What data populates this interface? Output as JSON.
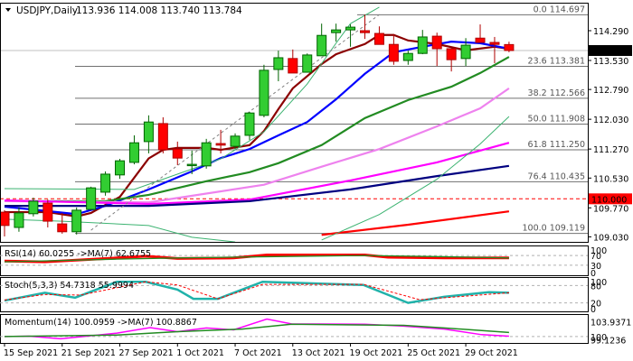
{
  "header": {
    "symbol": "USDJPY,Daily",
    "ohlc": "113.936 114.008 113.740 113.784"
  },
  "colors": {
    "bull": "#32cd32",
    "bear": "#ff0000",
    "bull_border": "#006400",
    "bear_border": "#b00000",
    "ma_fast": "#8b0000",
    "ma_blue": "#0000ff",
    "ma_green": "#228b22",
    "ma_violet": "#ee82ee",
    "ma_magenta": "#ff00ff",
    "ma_navy": "#000080",
    "ma_red": "#ff0000",
    "bollinger": "#3cb371",
    "stoch_main": "#20b2aa"
  },
  "chart_data": [
    {
      "type": "candlestick",
      "title": "USDJPY,Daily",
      "x_tick_labels": [
        {
          "bar": 0,
          "label": "15 Sep 2021"
        },
        {
          "bar": 4,
          "label": "21 Sep 2021"
        },
        {
          "bar": 8,
          "label": "27 Sep 2021"
        },
        {
          "bar": 12,
          "label": "1 Oct 2021"
        },
        {
          "bar": 16,
          "label": "7 Oct 2021"
        },
        {
          "bar": 20,
          "label": "13 Oct 2021"
        },
        {
          "bar": 24,
          "label": "19 Oct 2021"
        },
        {
          "bar": 28,
          "label": "25 Oct 2021"
        },
        {
          "bar": 32,
          "label": "29 Oct 2021"
        }
      ],
      "y_tick_labels": [
        "114.290",
        "113.530",
        "112.790",
        "112.030",
        "111.270",
        "110.530",
        "109.770",
        "109.030"
      ],
      "ylim": [
        109.0,
        114.75
      ],
      "current_price": {
        "label": "113.784",
        "value": 113.784
      },
      "level_line": {
        "label": "110.000",
        "value": 110.0
      },
      "candles": [
        [
          109.66,
          109.71,
          109.04,
          109.32
        ],
        [
          109.27,
          109.78,
          109.16,
          109.64
        ],
        [
          109.62,
          110.03,
          109.55,
          109.94
        ],
        [
          109.89,
          109.98,
          109.27,
          109.43
        ],
        [
          109.36,
          109.64,
          109.11,
          109.16
        ],
        [
          109.16,
          109.78,
          109.09,
          109.71
        ],
        [
          109.73,
          110.31,
          109.71,
          110.28
        ],
        [
          110.17,
          110.7,
          110.08,
          110.63
        ],
        [
          110.61,
          111.02,
          110.51,
          110.97
        ],
        [
          110.93,
          111.62,
          110.88,
          111.43
        ],
        [
          111.46,
          112.13,
          111.16,
          111.96
        ],
        [
          111.92,
          112.08,
          111.16,
          111.25
        ],
        [
          111.27,
          111.46,
          110.86,
          111.04
        ],
        [
          110.86,
          111.23,
          110.63,
          110.88
        ],
        [
          110.84,
          111.53,
          110.77,
          111.43
        ],
        [
          111.41,
          111.76,
          111.16,
          111.37
        ],
        [
          111.34,
          111.67,
          111.27,
          111.6
        ],
        [
          111.62,
          112.22,
          111.5,
          112.19
        ],
        [
          112.13,
          113.42,
          112.08,
          113.28
        ],
        [
          113.3,
          113.78,
          113.0,
          113.6
        ],
        [
          113.58,
          113.81,
          113.21,
          113.21
        ],
        [
          113.23,
          113.71,
          113.23,
          113.67
        ],
        [
          113.65,
          114.47,
          113.65,
          114.17
        ],
        [
          114.24,
          114.47,
          114.01,
          114.31
        ],
        [
          114.31,
          114.45,
          113.88,
          114.38
        ],
        [
          114.29,
          114.7,
          114.08,
          114.24
        ],
        [
          114.22,
          114.4,
          113.94,
          113.94
        ],
        [
          113.94,
          114.2,
          113.42,
          113.51
        ],
        [
          113.53,
          113.78,
          113.42,
          113.71
        ],
        [
          113.71,
          114.31,
          113.69,
          114.13
        ],
        [
          114.15,
          114.24,
          113.39,
          113.83
        ],
        [
          113.83,
          113.83,
          113.25,
          113.55
        ],
        [
          113.58,
          114.1,
          113.39,
          113.92
        ],
        [
          114.1,
          114.45,
          113.99,
          113.99
        ],
        [
          113.99,
          114.13,
          113.46,
          113.94
        ],
        [
          113.936,
          114.008,
          113.74,
          113.784
        ]
      ],
      "overlays": [
        {
          "color": "#8b0000",
          "points": [
            [
              0,
              109.66
            ],
            [
              3,
              109.66
            ],
            [
              5,
              109.55
            ],
            [
              6,
              109.64
            ],
            [
              8,
              110.05
            ],
            [
              10,
              111.03
            ],
            [
              11,
              111.25
            ],
            [
              12,
              111.3
            ],
            [
              14,
              111.3
            ],
            [
              15,
              111.25
            ],
            [
              17,
              111.37
            ],
            [
              18,
              111.73
            ],
            [
              19,
              112.29
            ],
            [
              20,
              112.82
            ],
            [
              22,
              113.44
            ],
            [
              23,
              113.69
            ],
            [
              25,
              113.95
            ],
            [
              26,
              114.18
            ],
            [
              27,
              114.18
            ],
            [
              28,
              114.04
            ],
            [
              30,
              113.95
            ],
            [
              32,
              113.79
            ],
            [
              34,
              113.88
            ],
            [
              35,
              113.83
            ]
          ]
        },
        {
          "color": "#0000ff",
          "points": [
            [
              0,
              109.8
            ],
            [
              5,
              109.61
            ],
            [
              7,
              109.82
            ],
            [
              10,
              110.24
            ],
            [
              13,
              110.7
            ],
            [
              15,
              111.04
            ],
            [
              17,
              111.27
            ],
            [
              19,
              111.62
            ],
            [
              21,
              111.96
            ],
            [
              23,
              112.54
            ],
            [
              25,
              113.19
            ],
            [
              27,
              113.74
            ],
            [
              29,
              113.88
            ],
            [
              31,
              114.01
            ],
            [
              33,
              113.97
            ],
            [
              35,
              113.83
            ]
          ]
        },
        {
          "color": "#228b22",
          "points": [
            [
              0,
              109.94
            ],
            [
              7,
              109.94
            ],
            [
              10,
              110.1
            ],
            [
              14,
              110.45
            ],
            [
              17,
              110.68
            ],
            [
              19,
              110.91
            ],
            [
              22,
              111.37
            ],
            [
              25,
              112.06
            ],
            [
              28,
              112.52
            ],
            [
              31,
              112.86
            ],
            [
              33,
              113.21
            ],
            [
              35,
              113.62
            ]
          ]
        },
        {
          "color": "#ee82ee",
          "points": [
            [
              0,
              109.94
            ],
            [
              10,
              109.91
            ],
            [
              18,
              110.36
            ],
            [
              22,
              110.82
            ],
            [
              26,
              111.27
            ],
            [
              30,
              111.85
            ],
            [
              33,
              112.31
            ],
            [
              35,
              112.82
            ]
          ]
        },
        {
          "color": "#ff00ff",
          "points": [
            [
              0,
              109.96
            ],
            [
              10,
              109.87
            ],
            [
              17,
              109.98
            ],
            [
              24,
              110.47
            ],
            [
              30,
              110.93
            ],
            [
              35,
              111.43
            ]
          ]
        },
        {
          "color": "#000080",
          "points": [
            [
              0,
              109.82
            ],
            [
              10,
              109.82
            ],
            [
              17,
              109.94
            ],
            [
              24,
              110.24
            ],
            [
              30,
              110.58
            ],
            [
              35,
              110.84
            ]
          ]
        },
        {
          "color": "#ff0000",
          "points": [
            [
              22,
              109.08
            ],
            [
              28,
              109.34
            ],
            [
              35,
              109.68
            ]
          ]
        },
        {
          "color": "#3cb371",
          "points": [
            [
              0,
              110.26
            ],
            [
              9,
              110.24
            ],
            [
              15,
              111.02
            ],
            [
              18,
              111.71
            ],
            [
              21,
              112.93
            ],
            [
              23,
              113.97
            ],
            [
              24,
              114.47
            ],
            [
              26,
              114.89
            ]
          ]
        },
        {
          "color": "#3cb371",
          "points": [
            [
              0,
              109.48
            ],
            [
              4,
              109.43
            ],
            [
              10,
              109.32
            ],
            [
              13,
              109.02
            ],
            [
              16,
              108.9
            ]
          ]
        },
        {
          "color": "#3cb371",
          "points": [
            [
              22,
              108.95
            ],
            [
              26,
              109.6
            ],
            [
              30,
              110.5
            ],
            [
              33,
              111.4
            ],
            [
              35,
              112.1
            ]
          ]
        },
        {
          "color": "#808080",
          "dashed": true,
          "points": [
            [
              6,
              109.2
            ],
            [
              26,
              114.7
            ]
          ]
        }
      ],
      "fibonacci": [
        {
          "label": "0.0 114.697",
          "value": 114.697
        },
        {
          "label": "23.6 113.381",
          "value": 113.381
        },
        {
          "label": "38.2 112.566",
          "value": 112.566
        },
        {
          "label": "50.0 111.908",
          "value": 111.908
        },
        {
          "label": "61.8 111.250",
          "value": 111.25
        },
        {
          "label": "76.4 110.435",
          "value": 110.435
        },
        {
          "label": "100.0 109.119",
          "value": 109.119
        }
      ]
    },
    {
      "type": "line",
      "title": "RSI(14) 60.0255  ->MA(7) 62.6755",
      "ylim": [
        0,
        100
      ],
      "levels": [
        70,
        30
      ],
      "y_tick_labels": [
        "100",
        "70",
        "30",
        "0"
      ],
      "series": [
        {
          "color": "#ff0000",
          "width": 3,
          "points": [
            [
              0,
              47
            ],
            [
              2.8,
              44
            ],
            [
              7.8,
              60
            ],
            [
              9.8,
              67
            ],
            [
              12,
              58
            ],
            [
              15.9,
              60
            ],
            [
              18.2,
              72
            ],
            [
              25,
              72
            ],
            [
              26.6,
              63
            ],
            [
              30.5,
              60
            ],
            [
              35,
              60
            ]
          ]
        },
        {
          "color": "#228b22",
          "width": 1.3,
          "points": [
            [
              0,
              44
            ],
            [
              7.8,
              55
            ],
            [
              12,
              60
            ],
            [
              18.2,
              65
            ],
            [
              25,
              70
            ],
            [
              30.5,
              65
            ],
            [
              35,
              60
            ]
          ]
        }
      ]
    },
    {
      "type": "line",
      "title": "Stoch(5,3,3) 54.7318 55.9994",
      "ylim": [
        0,
        100
      ],
      "levels": [
        80,
        20
      ],
      "y_tick_labels": [
        "100",
        "80",
        "20",
        "0"
      ],
      "series": [
        {
          "color": "#20b2aa",
          "width": 2.5,
          "points": [
            [
              0,
              28
            ],
            [
              2.8,
              55
            ],
            [
              4.9,
              38
            ],
            [
              7.8,
              93
            ],
            [
              9.8,
              93
            ],
            [
              12,
              66
            ],
            [
              13.1,
              34
            ],
            [
              14.8,
              34
            ],
            [
              17.9,
              93
            ],
            [
              24.9,
              82
            ],
            [
              28,
              20
            ],
            [
              30.5,
              41
            ],
            [
              33.6,
              57
            ],
            [
              35,
              55
            ]
          ]
        },
        {
          "color": "#ff0000",
          "width": 1,
          "dashed": true,
          "points": [
            [
              0,
              30
            ],
            [
              2.8,
              49
            ],
            [
              5.3,
              47
            ],
            [
              9.8,
              93
            ],
            [
              12,
              82
            ],
            [
              14.8,
              34
            ],
            [
              17.9,
              84
            ],
            [
              24.9,
              84
            ],
            [
              28.8,
              31
            ],
            [
              35,
              55
            ]
          ]
        }
      ]
    },
    {
      "type": "line",
      "title": "Momentum(14) 100.0959  ->MA(7) 100.8867",
      "ylim": [
        99.0,
        105.3
      ],
      "levels": [
        100
      ],
      "y_tick_labels": [
        "103.9371",
        "100",
        "99.1236"
      ],
      "series": [
        {
          "color": "#ff00ff",
          "width": 1.5,
          "points": [
            [
              0,
              100
            ],
            [
              1.7,
              100.1
            ],
            [
              3.9,
              99.4
            ],
            [
              7.8,
              100.9
            ],
            [
              10.1,
              102.4
            ],
            [
              12,
              101.3
            ],
            [
              14,
              102.3
            ],
            [
              15.9,
              101.8
            ],
            [
              18.2,
              104.7
            ],
            [
              19.9,
              103.4
            ],
            [
              25,
              103.3
            ],
            [
              27.7,
              102.8
            ],
            [
              30.5,
              102.0
            ],
            [
              33.1,
              100.5
            ],
            [
              35,
              100.1
            ]
          ]
        },
        {
          "color": "#228b22",
          "width": 1.5,
          "points": [
            [
              0,
              100
            ],
            [
              7.8,
              100.4
            ],
            [
              12,
              101.3
            ],
            [
              16.5,
              102
            ],
            [
              19.9,
              103.3
            ],
            [
              27.7,
              103.0
            ],
            [
              30.5,
              102.3
            ],
            [
              35,
              101.1
            ]
          ]
        }
      ]
    }
  ]
}
